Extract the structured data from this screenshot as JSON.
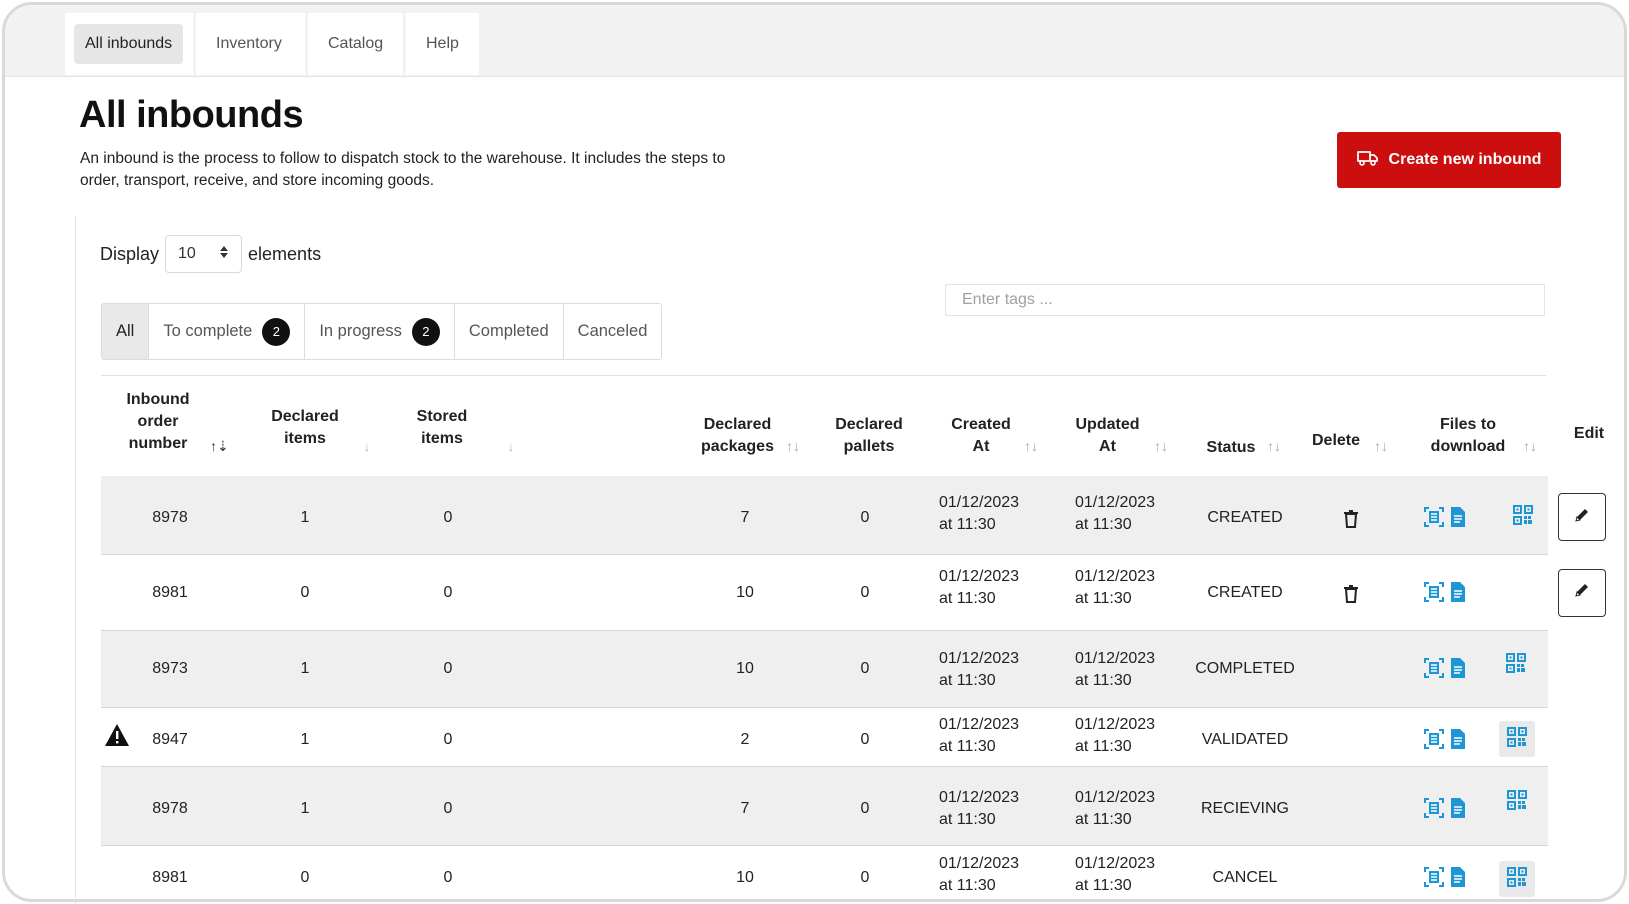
{
  "nav": {
    "tabs": [
      {
        "label": "All inbounds",
        "active": true
      },
      {
        "label": "Inventory"
      },
      {
        "label": "Catalog"
      },
      {
        "label": "Help"
      }
    ]
  },
  "page": {
    "title": "All inbounds",
    "description": "An inbound is the process to follow to dispatch stock to the warehouse. It includes the steps to order, transport, receive, and store incoming goods.",
    "create_button": "Create new inbound"
  },
  "display": {
    "prefix": "Display",
    "value": "10",
    "suffix": "elements"
  },
  "filters": [
    {
      "label": "All",
      "active": true
    },
    {
      "label": "To complete",
      "count": "2"
    },
    {
      "label": "In progress",
      "count": "2"
    },
    {
      "label": "Completed"
    },
    {
      "label": "Canceled"
    }
  ],
  "tags": {
    "placeholder": "Enter tags ..."
  },
  "table": {
    "headers": {
      "order_number": [
        "Inbound",
        "order",
        "number"
      ],
      "declared_items": [
        "Declared",
        "items"
      ],
      "stored_items": [
        "Stored",
        "items"
      ],
      "declared_packages": [
        "Declared",
        "packages"
      ],
      "declared_pallets": [
        "Declared",
        "pallets"
      ],
      "created_at": [
        "Created",
        "At"
      ],
      "updated_at": [
        "Updated",
        "At"
      ],
      "status": "Status",
      "delete": "Delete",
      "files": [
        "Files to",
        "download"
      ],
      "edit": "Edit"
    },
    "rows": [
      {
        "order": "8978",
        "declared_items": "1",
        "stored_items": "0",
        "packages": "7",
        "pallets": "0",
        "created_date": "01/12/2023",
        "created_time": "at 11:30",
        "updated_date": "01/12/2023",
        "updated_time": "at 11:30",
        "status": "CREATED",
        "deletable": true,
        "editable": true,
        "qr": true,
        "warning": false
      },
      {
        "order": "8981",
        "declared_items": "0",
        "stored_items": "0",
        "packages": "10",
        "pallets": "0",
        "created_date": "01/12/2023",
        "created_time": "at 11:30",
        "updated_date": "01/12/2023",
        "updated_time": "at 11:30",
        "status": "CREATED",
        "deletable": true,
        "editable": true,
        "qr": false,
        "warning": false
      },
      {
        "order": "8973",
        "declared_items": "1",
        "stored_items": "0",
        "packages": "10",
        "pallets": "0",
        "created_date": "01/12/2023",
        "created_time": "at 11:30",
        "updated_date": "01/12/2023",
        "updated_time": "at 11:30",
        "status": "COMPLETED",
        "deletable": false,
        "editable": false,
        "qr": true,
        "warning": false
      },
      {
        "order": "8947",
        "declared_items": "1",
        "stored_items": "0",
        "packages": "2",
        "pallets": "0",
        "created_date": "01/12/2023",
        "created_time": "at 11:30",
        "updated_date": "01/12/2023",
        "updated_time": "at 11:30",
        "status": "VALIDATED",
        "deletable": false,
        "editable": false,
        "qr": true,
        "warning": true
      },
      {
        "order": "8978",
        "declared_items": "1",
        "stored_items": "0",
        "packages": "7",
        "pallets": "0",
        "created_date": "01/12/2023",
        "created_time": "at 11:30",
        "updated_date": "01/12/2023",
        "updated_time": "at 11:30",
        "status": "RECIEVING",
        "deletable": false,
        "editable": false,
        "qr": true,
        "warning": false
      },
      {
        "order": "8981",
        "declared_items": "0",
        "stored_items": "0",
        "packages": "10",
        "pallets": "0",
        "created_date": "01/12/2023",
        "created_time": "at 11:30",
        "updated_date": "01/12/2023",
        "updated_time": "at 11:30",
        "status": "CANCEL",
        "deletable": false,
        "editable": false,
        "qr": true,
        "warning": false
      }
    ]
  },
  "colors": {
    "accent_red": "#cc0e0e",
    "icon_blue": "#1e96d6",
    "row_gray": "#efefef"
  }
}
